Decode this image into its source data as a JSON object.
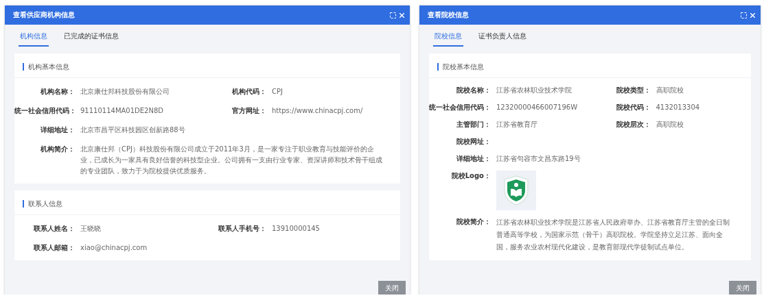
{
  "dialogs": [
    {
      "title": "查看供应商机构信息",
      "tabs": [
        {
          "label": "机构信息",
          "selected": true
        },
        {
          "label": "已完成的证书信息",
          "selected": false
        }
      ],
      "sections": [
        {
          "title": "机构基本信息",
          "fields": [
            {
              "kind": "text",
              "label": "机构名称：",
              "value": "北京康仕邦科技股份有限公司"
            },
            {
              "kind": "text",
              "label": "机构代码：",
              "value": "CPJ"
            },
            {
              "kind": "text",
              "label": "统一社会信用代码：",
              "value": "91110114MA01DE2N8D"
            },
            {
              "kind": "text",
              "label": "官方网址：",
              "value": "https://www.chinacpj.com/"
            },
            {
              "kind": "wide",
              "label": "详细地址：",
              "value": "北京市昌平区科技园区创新路88号"
            },
            {
              "kind": "wide",
              "label": "机构简介：",
              "value": "北京康仕邦（CPJ）科技股份有限公司成立于2011年3月，是一家专注于职业教育与技能评价的企业，已成长为一家具有良好信誉的科技型企业。公司拥有一支由行业专家、资深讲师和技术骨干组成的专业团队，致力于为院校提供优质服务。"
            }
          ]
        },
        {
          "title": "联系人信息",
          "fields": [
            {
              "kind": "text",
              "label": "联系人姓名：",
              "value": "王晓晓"
            },
            {
              "kind": "text",
              "label": "联系人手机号：",
              "value": "13910000145"
            },
            {
              "kind": "wide",
              "label": "联系人邮箱：",
              "value": "xiao@chinacpj.com"
            }
          ]
        }
      ],
      "close_button": "关闭"
    },
    {
      "title": "查看院校信息",
      "tabs": [
        {
          "label": "院校信息",
          "selected": true
        },
        {
          "label": "证书负责人信息",
          "selected": false
        }
      ],
      "sections": [
        {
          "title": "院校基本信息",
          "fields": [
            {
              "kind": "text",
              "label": "院校名称：",
              "value": "江苏省农林职业技术学院"
            },
            {
              "kind": "text",
              "label": "院校类型：",
              "value": "高职院校"
            },
            {
              "kind": "text",
              "label": "统一社会信用代码：",
              "value": "12320000466007196W"
            },
            {
              "kind": "text",
              "label": "院校代码：",
              "value": "4132013304"
            },
            {
              "kind": "text",
              "label": "主管部门：",
              "value": "江苏省教育厅"
            },
            {
              "kind": "text",
              "label": "院校层次：",
              "value": "高职院校"
            },
            {
              "kind": "wide",
              "label": "院校网址："
            },
            {
              "kind": "wide",
              "label": "详细地址：",
              "value": "江苏省句容市文昌东路19号"
            },
            {
              "kind": "logo",
              "label": "院校Logo："
            },
            {
              "kind": "wide",
              "label": "院校简介：",
              "value": "江苏省农林职业技术学院是江苏省人民政府举办、江苏省教育厅主管的全日制普通高等学校，为国家示范（骨干）高职院校。学院坚持立足江苏、面向全国，服务农业农村现代化建设，是教育部现代学徒制试点单位。"
            }
          ]
        }
      ],
      "close_button": "关闭"
    }
  ]
}
